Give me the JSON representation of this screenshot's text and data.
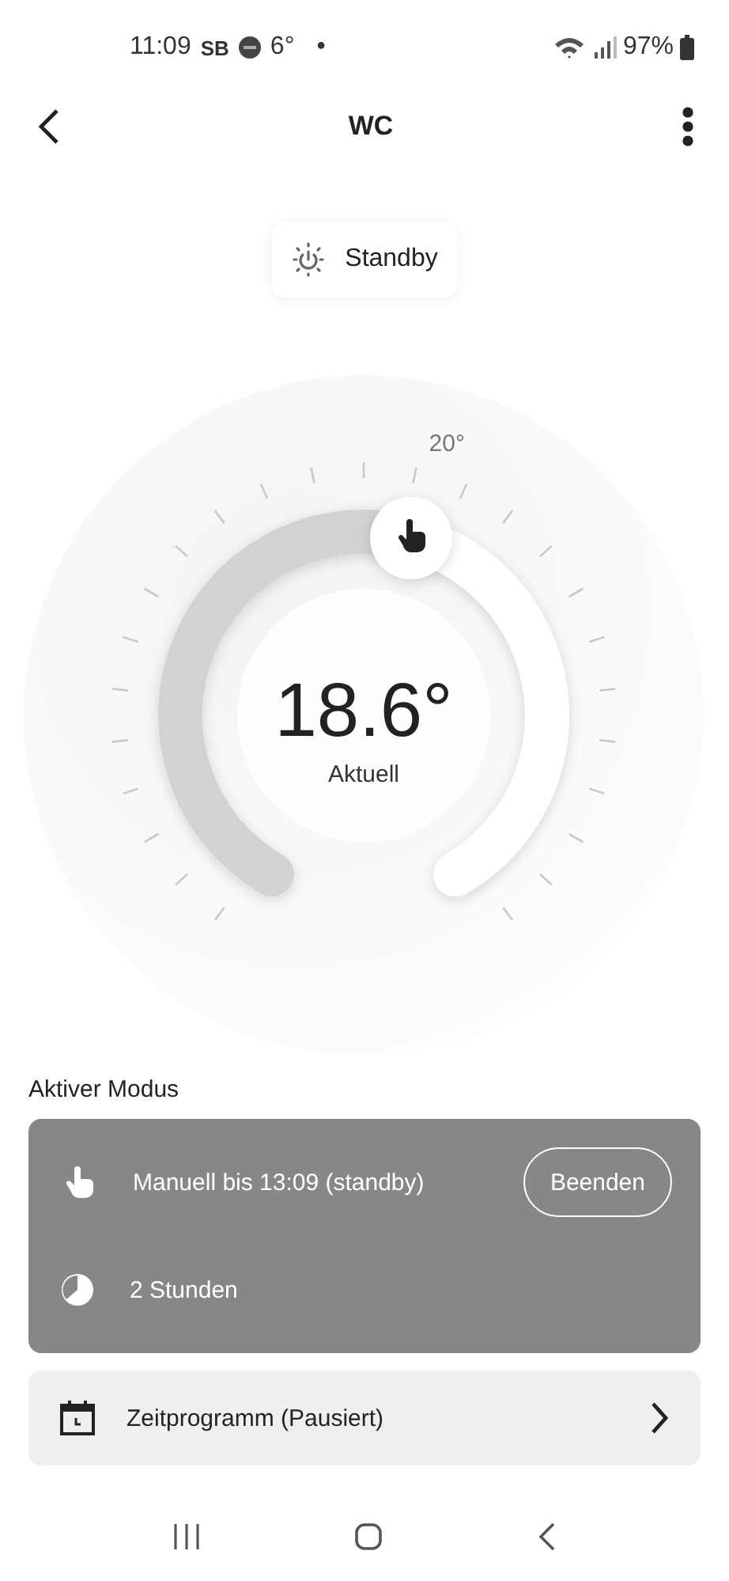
{
  "status_bar": {
    "time": "11:09",
    "carrier": "SB",
    "temperature": "6°",
    "dot": "•",
    "battery": "97%"
  },
  "header": {
    "title": "WC"
  },
  "mode_chip": {
    "label": "Standby"
  },
  "dial": {
    "target_label": "20°",
    "temperature": "18.6°",
    "caption": "Aktuell"
  },
  "active_mode": {
    "heading": "Aktiver Modus",
    "items": [
      {
        "kind": "manual",
        "text": "Manuell bis 13:09 (standby)",
        "button": "Beenden"
      },
      {
        "kind": "duration",
        "text": "2 Stunden"
      }
    ]
  },
  "schedule": {
    "label": "Zeitprogramm (Pausiert)"
  }
}
